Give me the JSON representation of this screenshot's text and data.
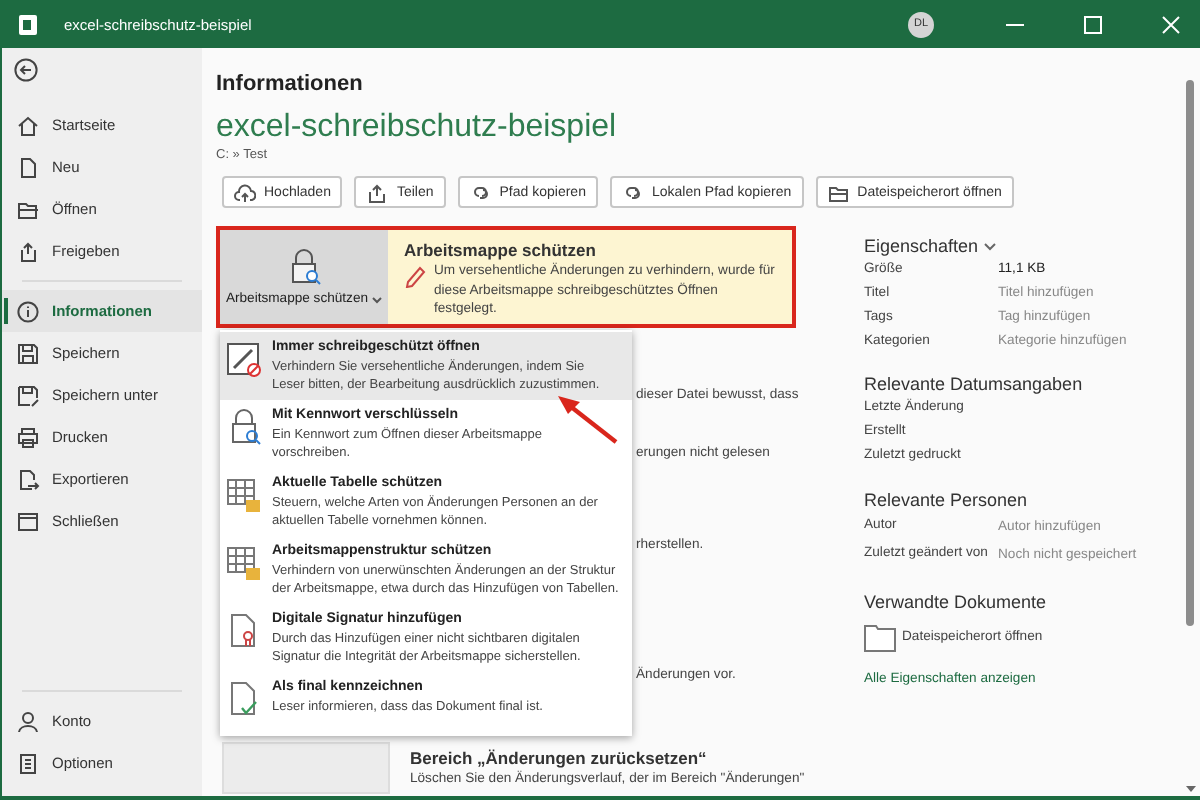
{
  "title_bar": {
    "title": "excel-schreibschutz-beispiel",
    "account_initials": "DL"
  },
  "sidebar": {
    "sections": [
      {
        "items": [
          {
            "label": "Startseite",
            "selected": false
          },
          {
            "label": "Neu",
            "selected": false
          },
          {
            "label": "Öffnen",
            "selected": false
          },
          {
            "label": "Freigeben",
            "selected": false
          }
        ]
      },
      {
        "items": [
          {
            "label": "Informationen",
            "selected": true
          },
          {
            "label": "Speichern",
            "selected": false
          },
          {
            "label": "Speichern unter",
            "selected": false
          },
          {
            "label": "Drucken",
            "selected": false
          },
          {
            "label": "Exportieren",
            "selected": false
          },
          {
            "label": "Schließen",
            "selected": false
          }
        ]
      }
    ],
    "footer": [
      {
        "label": "Konto",
        "selected": false
      },
      {
        "label": "Optionen",
        "selected": false
      }
    ]
  },
  "main": {
    "heading": "Informationen",
    "file_name": "excel-schreibschutz-beispiel",
    "path": "C: » Test",
    "actions": [
      "Hochladen",
      "Teilen",
      "Pfad kopieren",
      "Lokalen Pfad kopieren",
      "Dateispeicherort öffnen"
    ],
    "protect": {
      "button_label": "Arbeitsmappe schützen",
      "title": "Arbeitsmappe schützen",
      "description": "Um versehentliche Änderungen zu verhindern, wurde für diese Arbeitsmappe schreibgeschütztes Öffnen festgelegt.",
      "expanded": true
    },
    "protect_menu": [
      {
        "title": "Immer schreibgeschützt öffnen",
        "description": "Verhindern Sie versehentliche Änderungen, indem Sie Leser bitten, der Bearbeitung ausdrücklich zuzustimmen.",
        "selected": true
      },
      {
        "title": "Mit Kennwort verschlüsseln",
        "description": "Ein Kennwort zum Öffnen dieser Arbeitsmappe vorschreiben.",
        "selected": false
      },
      {
        "title": "Aktuelle Tabelle schützen",
        "description": "Steuern, welche Arten von Änderungen Personen an der aktuellen Tabelle vornehmen können.",
        "selected": false
      },
      {
        "title": "Arbeitsmappenstruktur schützen",
        "description": "Verhindern von unerwünschten Änderungen an der Struktur der Arbeitsmappe, etwa durch das Hinzufügen von Tabellen.",
        "selected": false
      },
      {
        "title": "Digitale Signatur hinzufügen",
        "description": "Durch das Hinzufügen einer nicht sichtbaren digitalen Signatur die Integrität der Arbeitsmappe sicherstellen.",
        "selected": false
      },
      {
        "title": "Als final kennzeichnen",
        "description": "Leser informieren, dass das Dokument final ist.",
        "selected": false
      }
    ],
    "covered_texts": [
      "dieser Datei bewusst, dass",
      "erungen nicht gelesen",
      "rherstellen.",
      "Änderungen vor."
    ],
    "reset_section": {
      "title": "Bereich „Änderungen zurücksetzen“",
      "description": "Löschen Sie den Änderungsverlauf, der im Bereich \"Änderungen\""
    }
  },
  "properties": {
    "heading": "Eigenschaften",
    "rows": [
      {
        "label": "Größe",
        "value": "11,1 KB",
        "kind": "value"
      },
      {
        "label": "Titel",
        "placeholder": "Titel hinzufügen",
        "kind": "field"
      },
      {
        "label": "Tags",
        "placeholder": "Tag hinzufügen",
        "kind": "field"
      },
      {
        "label": "Kategorien",
        "placeholder": "Kategorie hinzufügen",
        "kind": "field"
      }
    ]
  },
  "dates": {
    "heading": "Relevante Datumsangaben",
    "rows": [
      "Letzte Änderung",
      "Erstellt",
      "Zuletzt gedruckt"
    ]
  },
  "people": {
    "heading": "Relevante Personen",
    "rows": [
      {
        "label": "Autor",
        "placeholder": "Autor hinzufügen",
        "kind": "field"
      },
      {
        "label": "Zuletzt geändert von",
        "placeholder": "Noch nicht gespeichert",
        "kind": "field"
      }
    ]
  },
  "related": {
    "heading": "Verwandte Dokumente",
    "items": [
      "Dateispeicherort öffnen"
    ],
    "link": "Alle Eigenschaften anzeigen"
  }
}
